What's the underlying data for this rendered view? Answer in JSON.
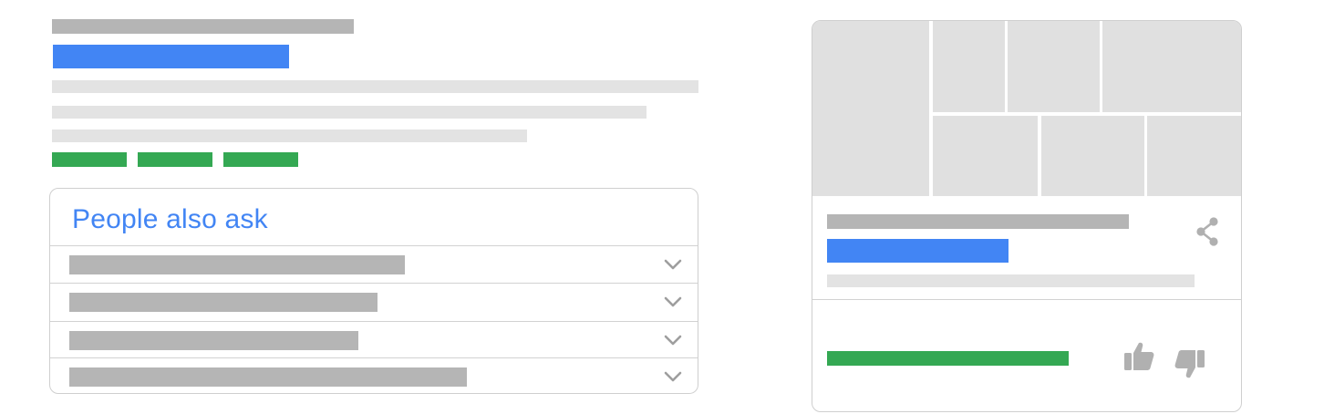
{
  "search_result": {
    "title_placeholder": "",
    "link_placeholder": "",
    "tags": [
      "",
      "",
      ""
    ]
  },
  "people_also_ask": {
    "heading": "People also ask",
    "questions": [
      {
        "text": "",
        "expanded": false
      },
      {
        "text": "",
        "expanded": false
      },
      {
        "text": "",
        "expanded": false
      },
      {
        "text": "",
        "expanded": false
      }
    ]
  },
  "knowledge_panel": {
    "images": [
      "image-1",
      "image-2",
      "image-3",
      "image-4",
      "image-5",
      "image-6",
      "image-7"
    ],
    "icons": {
      "share": "share-icon",
      "thumbs_up": "thumbs-up-icon",
      "thumbs_down": "thumbs-down-icon"
    }
  },
  "colors": {
    "link_blue": "#4285f4",
    "tag_green": "#34a853",
    "placeholder_dark": "#b5b5b5",
    "placeholder_light": "#e3e3e3",
    "image_placeholder": "#e0e0e0",
    "icon_gray": "#b0b0b0"
  }
}
